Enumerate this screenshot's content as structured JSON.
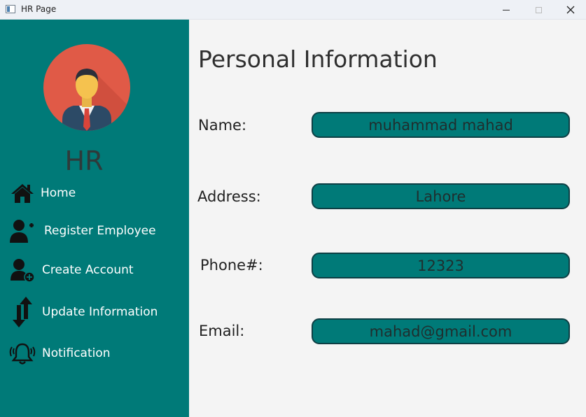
{
  "window": {
    "title": "HR Page"
  },
  "sidebar": {
    "role": "HR",
    "items": [
      {
        "label": "Home",
        "icon": "home-icon"
      },
      {
        "label": "Register Employee",
        "icon": "add-user-icon"
      },
      {
        "label": "Create Account",
        "icon": "user-plus-circle-icon"
      },
      {
        "label": "Update Information",
        "icon": "up-down-arrows-icon"
      },
      {
        "label": "Notification",
        "icon": "bell-ringing-icon"
      }
    ]
  },
  "main": {
    "title": "Personal Information",
    "fields": [
      {
        "label": "Name:",
        "value": "muhammad mahad"
      },
      {
        "label": "Address:",
        "value": "Lahore"
      },
      {
        "label": "Phone#:",
        "value": "12323"
      },
      {
        "label": "Email:",
        "value": "mahad@gmail.com"
      }
    ]
  },
  "colors": {
    "sidebar": "#007a78",
    "field_bg": "#007a78",
    "field_border": "#0d3f44",
    "avatar_bg": "#e05a47"
  }
}
